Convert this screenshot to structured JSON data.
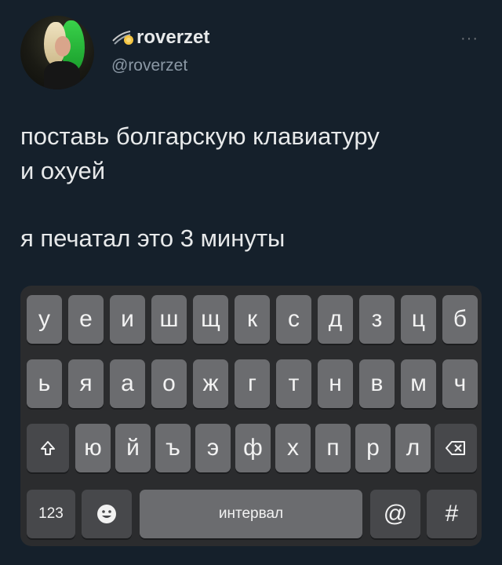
{
  "tweet": {
    "display_name": "roverzet",
    "handle": "@roverzet",
    "more": "···",
    "text_line1": "поставь болгарскую клавиатуру",
    "text_line2": "и охуей",
    "text_line3": "я печатал это 3 минуты"
  },
  "keyboard": {
    "row1": [
      "у",
      "е",
      "и",
      "ш",
      "щ",
      "к",
      "с",
      "д",
      "з",
      "ц",
      "б"
    ],
    "row2": [
      "ь",
      "я",
      "а",
      "о",
      "ж",
      "г",
      "т",
      "н",
      "в",
      "м",
      "ч"
    ],
    "row3": [
      "ю",
      "й",
      "ъ",
      "э",
      "ф",
      "х",
      "п",
      "р",
      "л"
    ],
    "numbers_label": "123",
    "space_label": "интервал",
    "at_label": "@",
    "hash_label": "#"
  },
  "icons": {
    "name_icon": "comet-icon",
    "shift": "shift-icon",
    "backspace": "backspace-icon",
    "emoji": "emoji-icon"
  },
  "colors": {
    "background": "#15202b",
    "keyboard": "#2b2c2e",
    "key": "#6b6c6f",
    "key_dark": "#47484b"
  }
}
